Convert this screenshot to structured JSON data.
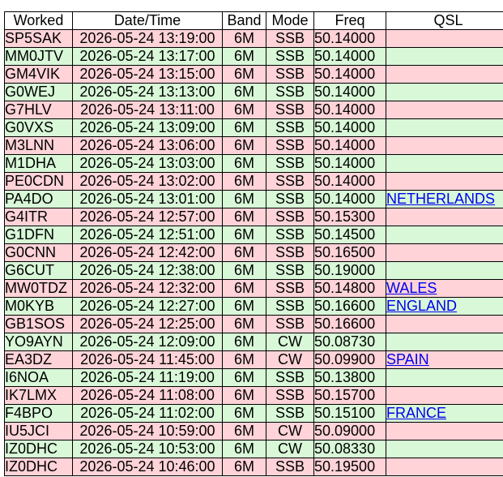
{
  "header": {
    "worked": "Worked",
    "datetime": "Date/Time",
    "band": "Band",
    "mode": "Mode",
    "freq": "Freq",
    "qsl": "QSL"
  },
  "row_colors": {
    "pink": "#ffd3d8",
    "green": "#d8f8d8",
    "link": "#0000ee"
  },
  "rows": [
    {
      "call": "SP5SAK",
      "datetime": "2026-05-24 13:19:00",
      "band": "6M",
      "mode": "SSB",
      "freq": "50.14000",
      "qsl": "",
      "color": "pink"
    },
    {
      "call": "MM0JTV",
      "datetime": "2026-05-24 13:17:00",
      "band": "6M",
      "mode": "SSB",
      "freq": "50.14000",
      "qsl": "",
      "color": "green"
    },
    {
      "call": "GM4VIK",
      "datetime": "2026-05-24 13:15:00",
      "band": "6M",
      "mode": "SSB",
      "freq": "50.14000",
      "qsl": "",
      "color": "pink"
    },
    {
      "call": "G0WEJ",
      "datetime": "2026-05-24 13:13:00",
      "band": "6M",
      "mode": "SSB",
      "freq": "50.14000",
      "qsl": "",
      "color": "green"
    },
    {
      "call": "G7HLV",
      "datetime": "2026-05-24 13:11:00",
      "band": "6M",
      "mode": "SSB",
      "freq": "50.14000",
      "qsl": "",
      "color": "pink"
    },
    {
      "call": "G0VXS",
      "datetime": "2026-05-24 13:09:00",
      "band": "6M",
      "mode": "SSB",
      "freq": "50.14000",
      "qsl": "",
      "color": "green"
    },
    {
      "call": "M3LNN",
      "datetime": "2026-05-24 13:06:00",
      "band": "6M",
      "mode": "SSB",
      "freq": "50.14000",
      "qsl": "",
      "color": "pink"
    },
    {
      "call": "M1DHA",
      "datetime": "2026-05-24 13:03:00",
      "band": "6M",
      "mode": "SSB",
      "freq": "50.14000",
      "qsl": "",
      "color": "green"
    },
    {
      "call": "PE0CDN",
      "datetime": "2026-05-24 13:02:00",
      "band": "6M",
      "mode": "SSB",
      "freq": "50.14000",
      "qsl": "",
      "color": "pink"
    },
    {
      "call": "PA4DO",
      "datetime": "2026-05-24 13:01:00",
      "band": "6M",
      "mode": "SSB",
      "freq": "50.14000",
      "qsl": "NETHERLANDS",
      "color": "green"
    },
    {
      "call": "G4ITR",
      "datetime": "2026-05-24 12:57:00",
      "band": "6M",
      "mode": "SSB",
      "freq": "50.15300",
      "qsl": "",
      "color": "pink"
    },
    {
      "call": "G1DFN",
      "datetime": "2026-05-24 12:51:00",
      "band": "6M",
      "mode": "SSB",
      "freq": "50.14500",
      "qsl": "",
      "color": "green"
    },
    {
      "call": "G0CNN",
      "datetime": "2026-05-24 12:42:00",
      "band": "6M",
      "mode": "SSB",
      "freq": "50.16500",
      "qsl": "",
      "color": "pink"
    },
    {
      "call": "G6CUT",
      "datetime": "2026-05-24 12:38:00",
      "band": "6M",
      "mode": "SSB",
      "freq": "50.19000",
      "qsl": "",
      "color": "green"
    },
    {
      "call": "MW0TDZ",
      "datetime": "2026-05-24 12:32:00",
      "band": "6M",
      "mode": "SSB",
      "freq": "50.14800",
      "qsl": "WALES",
      "color": "pink"
    },
    {
      "call": "M0KYB",
      "datetime": "2026-05-24 12:27:00",
      "band": "6M",
      "mode": "SSB",
      "freq": "50.16600",
      "qsl": "ENGLAND",
      "color": "green"
    },
    {
      "call": "GB1SOS",
      "datetime": "2026-05-24 12:25:00",
      "band": "6M",
      "mode": "SSB",
      "freq": "50.16600",
      "qsl": "",
      "color": "pink"
    },
    {
      "call": "YO9AYN",
      "datetime": "2026-05-24 12:09:00",
      "band": "6M",
      "mode": "CW",
      "freq": "50.08730",
      "qsl": "",
      "color": "green"
    },
    {
      "call": "EA3DZ",
      "datetime": "2026-05-24 11:45:00",
      "band": "6M",
      "mode": "CW",
      "freq": "50.09900",
      "qsl": "SPAIN",
      "color": "pink"
    },
    {
      "call": "I6NOA",
      "datetime": "2026-05-24 11:19:00",
      "band": "6M",
      "mode": "SSB",
      "freq": "50.13800",
      "qsl": "",
      "color": "green"
    },
    {
      "call": "IK7LMX",
      "datetime": "2026-05-24 11:08:00",
      "band": "6M",
      "mode": "SSB",
      "freq": "50.15700",
      "qsl": "",
      "color": "pink"
    },
    {
      "call": "F4BPO",
      "datetime": "2026-05-24 11:02:00",
      "band": "6M",
      "mode": "SSB",
      "freq": "50.15100",
      "qsl": "FRANCE",
      "color": "green"
    },
    {
      "call": "IU5JCI",
      "datetime": "2026-05-24 10:59:00",
      "band": "6M",
      "mode": "CW",
      "freq": "50.09000",
      "qsl": "",
      "color": "pink"
    },
    {
      "call": "IZ0DHC",
      "datetime": "2026-05-24 10:53:00",
      "band": "6M",
      "mode": "CW",
      "freq": "50.08330",
      "qsl": "",
      "color": "green"
    },
    {
      "call": "IZ0DHC",
      "datetime": "2026-05-24 10:46:00",
      "band": "6M",
      "mode": "SSB",
      "freq": "50.19500",
      "qsl": "",
      "color": "pink"
    }
  ]
}
